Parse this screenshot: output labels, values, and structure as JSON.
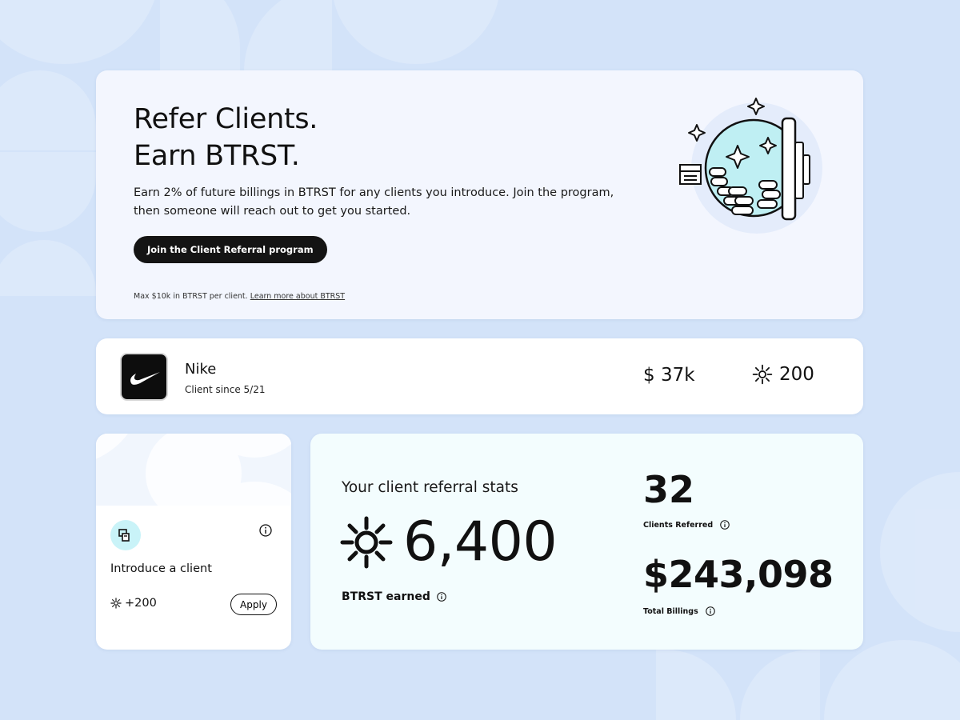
{
  "hero": {
    "title_line1": "Refer Clients.",
    "title_line2": "Earn BTRST.",
    "description": "Earn 2% of future billings in BTRST for any clients you introduce. Join the program, then someone will reach out to get you started.",
    "cta_label": "Join the Client Referral program",
    "fine_print": "Max $10k in BTRST per client.",
    "learn_more_label": "Learn more about BTRST",
    "illustration_icon": "vault-stars-illustration"
  },
  "client": {
    "name": "Nike",
    "since": "Client since 5/21",
    "billing": "$ 37k",
    "btrst": "200",
    "logo_icon": "nike-swoosh-logo"
  },
  "introduce": {
    "title": "Introduce a client",
    "reward": "+200",
    "apply_label": "Apply",
    "icon": "handshake-icon",
    "info_icon": "info-icon"
  },
  "stats": {
    "heading": "Your client referral stats",
    "btrst_earned": "6,400",
    "btrst_earned_label": "BTRST earned",
    "clients_referred": "32",
    "clients_referred_label": "Clients Referred",
    "total_billings": "$243,098",
    "total_billings_label": "Total Billings"
  },
  "colors": {
    "background": "#d3e3f9",
    "hero_bg": "#f3f6fe",
    "stats_bg": "#f3fdfe",
    "accent_cyan": "#c9f3f8",
    "button_dark": "#141414"
  }
}
